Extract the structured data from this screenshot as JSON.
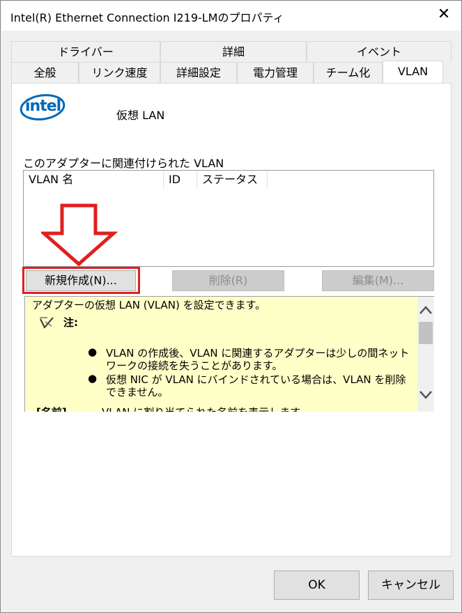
{
  "window": {
    "title": "Intel(R) Ethernet Connection I219-LMのプロパティ",
    "close_glyph": "✕"
  },
  "tabs": {
    "row1": [
      "ドライバー",
      "詳細",
      "イベント"
    ],
    "row2": [
      "全般",
      "リンク速度",
      "詳細設定",
      "電力管理",
      "チーム化",
      "VLAN"
    ],
    "active": "VLAN"
  },
  "panel": {
    "logo_text": "intel",
    "heading": "仮想 LAN",
    "list_label": "このアダプターに関連付けられた VLAN",
    "columns": [
      "VLAN 名",
      "ID",
      "ステータス"
    ],
    "buttons": {
      "new": "新規作成(N)...",
      "delete": "削除(R)",
      "edit": "編集(M)..."
    }
  },
  "help": {
    "intro": "アダプターの仮想 LAN (VLAN) を設定できます。",
    "note_label": "注:",
    "bullets": [
      [
        "VLAN の作成後、VLAN に関連するアダプターは少しの間ネット",
        "ワークの接続を失うことがあります。"
      ],
      [
        "仮想 NIC が VLAN にバインドされている場合は、VLAN を削除",
        "できません。"
      ]
    ],
    "cut_line_label": "[名前]",
    "cut_line_text": "VLAN に割り当てられた名前を表示します。"
  },
  "footer": {
    "ok": "OK",
    "cancel": "キャンセル"
  },
  "colors": {
    "annotation_red": "#e02020",
    "help_bg": "#ffffc8",
    "intel_blue": "#0068b5"
  }
}
